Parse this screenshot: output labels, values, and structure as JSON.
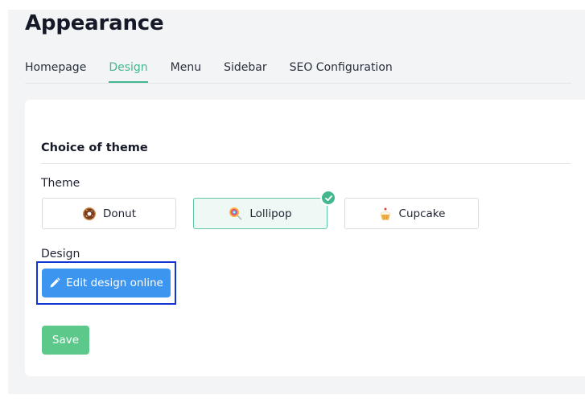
{
  "page": {
    "title": "Appearance"
  },
  "tabs": [
    {
      "label": "Homepage"
    },
    {
      "label": "Design"
    },
    {
      "label": "Menu"
    },
    {
      "label": "Sidebar"
    },
    {
      "label": "SEO Configuration"
    }
  ],
  "active_tab": "Design",
  "section": {
    "title": "Choice of theme"
  },
  "theme": {
    "label": "Theme",
    "selected": "Lollipop",
    "options": [
      {
        "label": "Donut",
        "icon": "donut-icon"
      },
      {
        "label": "Lollipop",
        "icon": "lollipop-icon"
      },
      {
        "label": "Cupcake",
        "icon": "cupcake-icon"
      }
    ]
  },
  "design": {
    "label": "Design",
    "edit_button": "Edit design online",
    "edit_icon": "pencil-icon"
  },
  "actions": {
    "save": "Save"
  },
  "colors": {
    "accent": "#43b88f",
    "primary_button": "#3c95ef",
    "save_button": "#5cc98a",
    "focus_outline": "#1334d4"
  }
}
